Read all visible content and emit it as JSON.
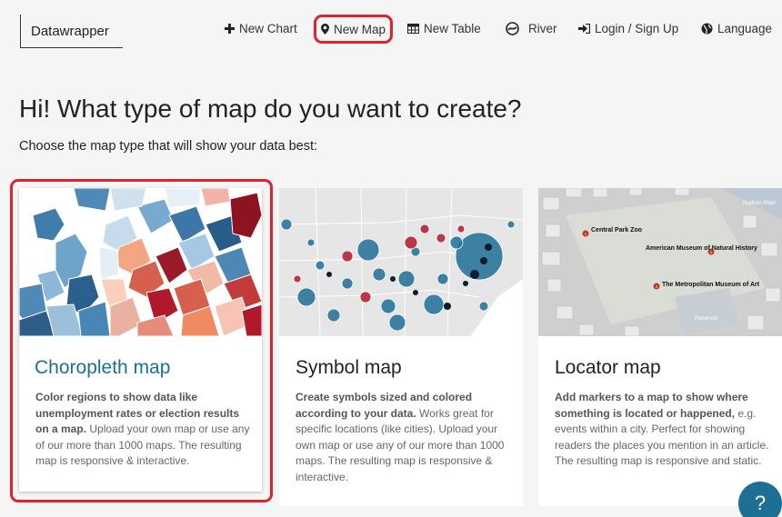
{
  "brand": {
    "logo": "Datawrapper"
  },
  "nav": [
    {
      "icon": "plus-icon",
      "label": "New Chart"
    },
    {
      "icon": "map-marker-icon",
      "label": "New Map"
    },
    {
      "icon": "table-icon",
      "label": "New Table"
    },
    {
      "icon": "river-icon",
      "label": "River"
    },
    {
      "icon": "sign-in-icon",
      "label": "Login / Sign Up"
    },
    {
      "icon": "globe-icon",
      "label": "Language"
    }
  ],
  "page": {
    "heading": "Hi! What type of map do you want to create?",
    "subheading": "Choose the map type that will show your data best:"
  },
  "cards": [
    {
      "title": "Choropleth map",
      "desc_bold": "Color regions to show data like unemployment rates or election results on a map.",
      "desc_rest": " Upload your own map or use any of our more than 1000 maps. The resulting map is responsive & interactive."
    },
    {
      "title": "Symbol map",
      "desc_bold": "Create symbols sized and colored according to your data.",
      "desc_rest": " Works great for specific locations (like cities). Upload your own map or use any of our more than 1000 maps. The resulting map is responsive & interactive."
    },
    {
      "title": "Locator map",
      "desc_bold": "Add markers to a map to show where something is located or happened,",
      "desc_rest": " e.g. events within a city. Perfect for showing readers the places you mention in an article. The resulting map is responsive and static.",
      "map_labels": [
        "Central Park Zoo",
        "American Museum of Natural History",
        "The Metropolitan Museum of Art",
        "Hudson River",
        "Reservoir"
      ],
      "marker_numbers": [
        "1",
        "2",
        "3"
      ]
    }
  ],
  "help": {
    "label": "?"
  },
  "colors": {
    "accent": "#1d6f95",
    "highlight": "#e0222e",
    "choropleth_red": "#b2182b",
    "choropleth_blue": "#2166ac"
  }
}
